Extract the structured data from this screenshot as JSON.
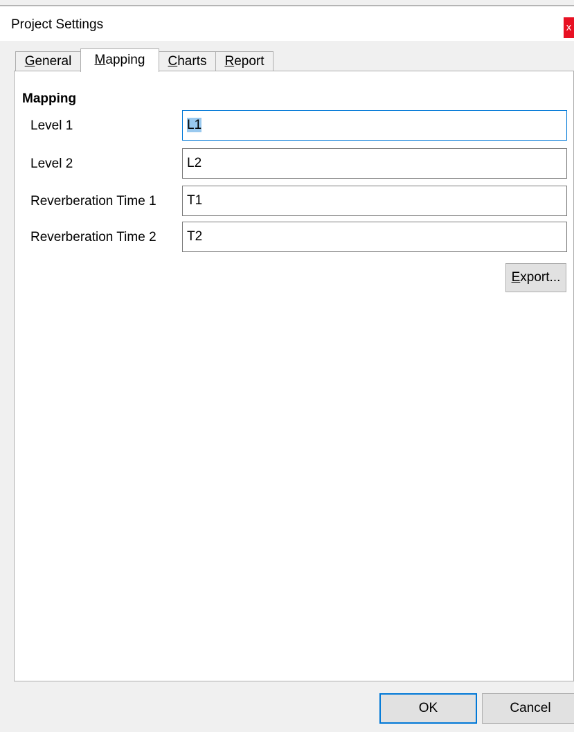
{
  "window": {
    "title": "Project Settings",
    "close_glyph": "x"
  },
  "tabs": [
    {
      "label": "General",
      "mnemonic": "G",
      "rest": "eneral",
      "active": false
    },
    {
      "label": "Mapping",
      "mnemonic": "M",
      "rest": "apping",
      "active": true
    },
    {
      "label": "Charts",
      "mnemonic": "C",
      "rest": "harts",
      "active": false
    },
    {
      "label": "Report",
      "mnemonic": "R",
      "rest": "eport",
      "active": false
    }
  ],
  "mapping": {
    "section_title": "Mapping",
    "rows": [
      {
        "label": "Level 1",
        "value": "L1"
      },
      {
        "label": "Level 2",
        "value": "L2"
      },
      {
        "label": "Reverberation Time 1",
        "value": "T1"
      },
      {
        "label": "Reverberation Time 2",
        "value": "T2"
      }
    ],
    "export_button": {
      "label": "Export...",
      "mnemonic": "E",
      "rest": "xport..."
    }
  },
  "footer": {
    "ok_label": "OK",
    "cancel_label": "Cancel"
  },
  "colors": {
    "accent": "#0078d7",
    "selection": "#99c9ef",
    "close": "#e81123"
  },
  "icons": {
    "close": "close-icon"
  }
}
